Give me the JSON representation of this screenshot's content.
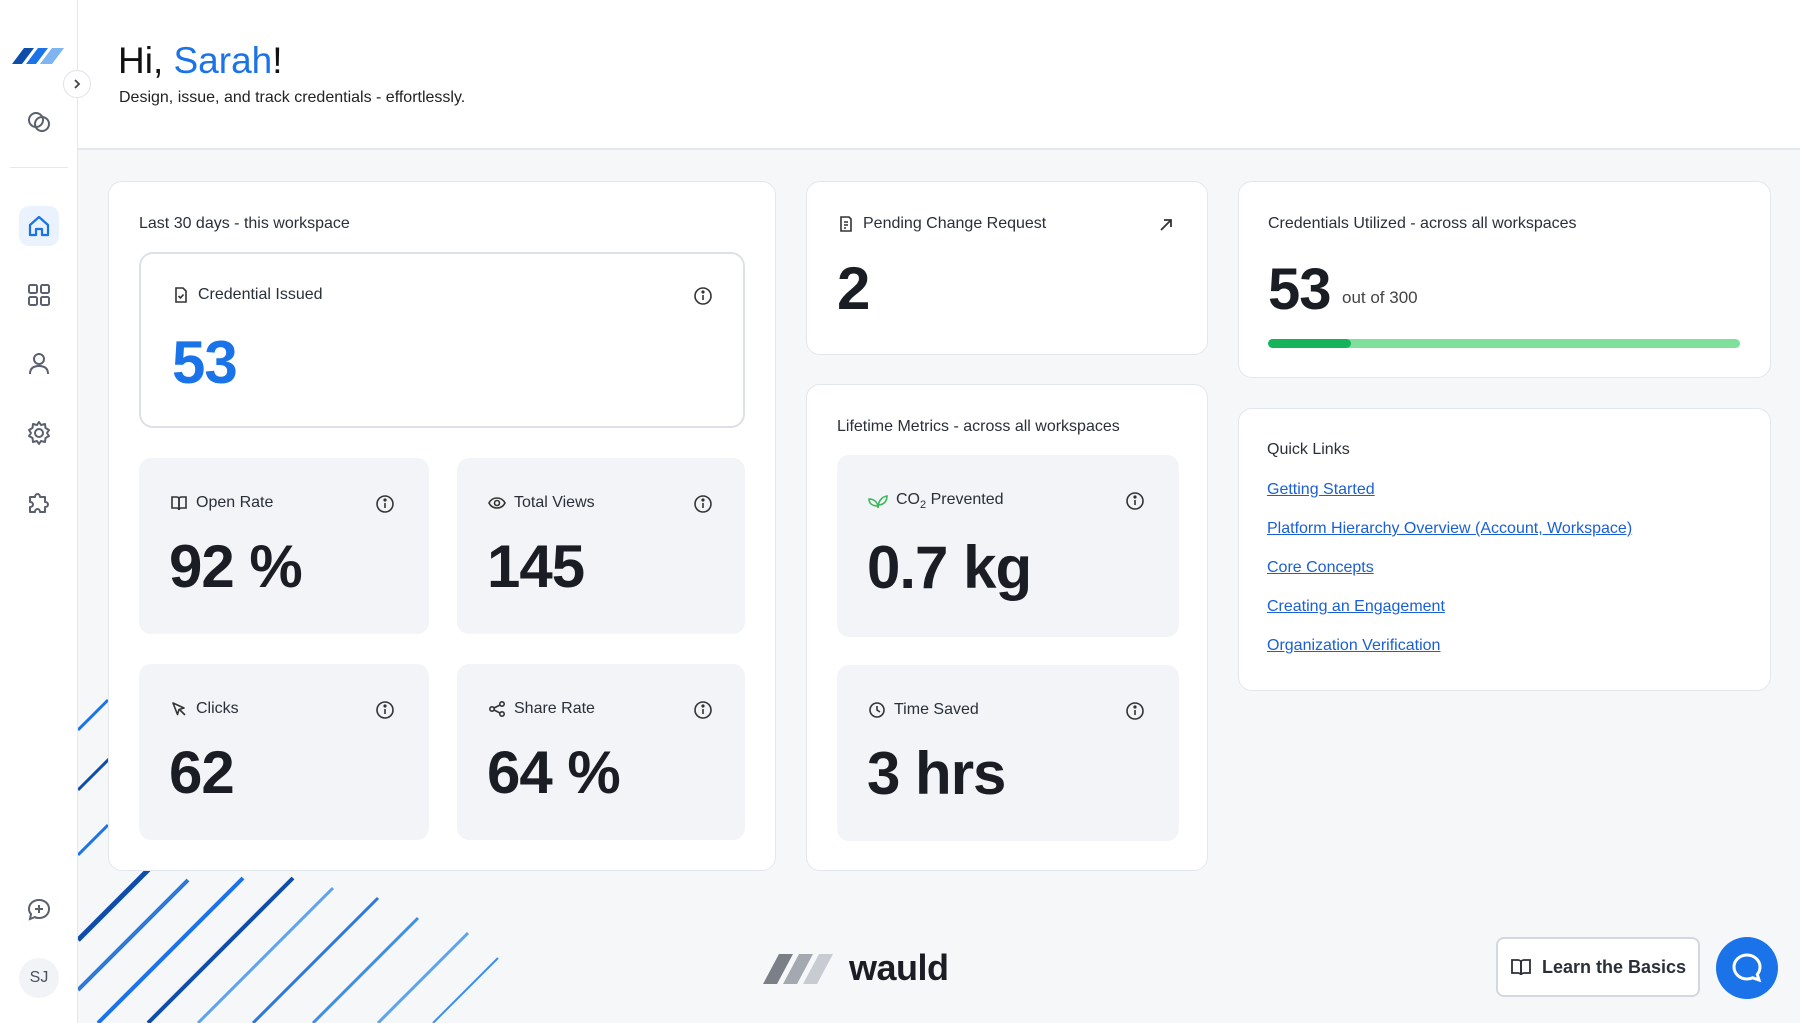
{
  "colors": {
    "accent": "#1a73e8",
    "progress_fill": "#16b45a",
    "progress_track": "#7ee09a",
    "link": "#1a5fd6"
  },
  "header": {
    "greeting_prefix": "Hi, ",
    "user_name": "Sarah",
    "greeting_suffix": "!",
    "tagline": "Design, issue, and track credentials - effortlessly."
  },
  "sidebar": {
    "items": [
      {
        "name": "home",
        "icon": "home-icon",
        "active": true
      },
      {
        "name": "dashboard",
        "icon": "grid-icon",
        "active": false
      },
      {
        "name": "users",
        "icon": "user-icon",
        "active": false
      },
      {
        "name": "settings",
        "icon": "gear-icon",
        "active": false
      },
      {
        "name": "integrations",
        "icon": "puzzle-icon",
        "active": false
      }
    ],
    "avatar_initials": "SJ"
  },
  "workspace_stats": {
    "label": "Last 30 days - this workspace",
    "credential_issued": {
      "label": "Credential Issued",
      "value": "53"
    },
    "open_rate": {
      "label": "Open Rate",
      "value": "92 %"
    },
    "total_views": {
      "label": "Total Views",
      "value": "145"
    },
    "clicks": {
      "label": "Clicks",
      "value": "62"
    },
    "share_rate": {
      "label": "Share Rate",
      "value": "64 %"
    }
  },
  "pending_change": {
    "label": "Pending Change Request",
    "value": "2"
  },
  "lifetime": {
    "label": "Lifetime Metrics - across all workspaces",
    "co2": {
      "label_prefix": "CO",
      "label_sub": "2",
      "label_suffix": " Prevented",
      "value": "0.7 kg"
    },
    "time_saved": {
      "label": "Time Saved",
      "value": "3 hrs"
    }
  },
  "credentials_utilized": {
    "label": "Credentials Utilized - across all workspaces",
    "used": "53",
    "total_text": "out of 300",
    "fraction": 0.1767
  },
  "quick_links": {
    "title": "Quick Links",
    "links": [
      "Getting Started",
      "Platform Hierarchy Overview (Account, Workspace)",
      "Core Concepts",
      "Creating an Engagement",
      "Organization Verification"
    ]
  },
  "footer": {
    "brand": "wauld",
    "learn_button": "Learn the Basics"
  }
}
